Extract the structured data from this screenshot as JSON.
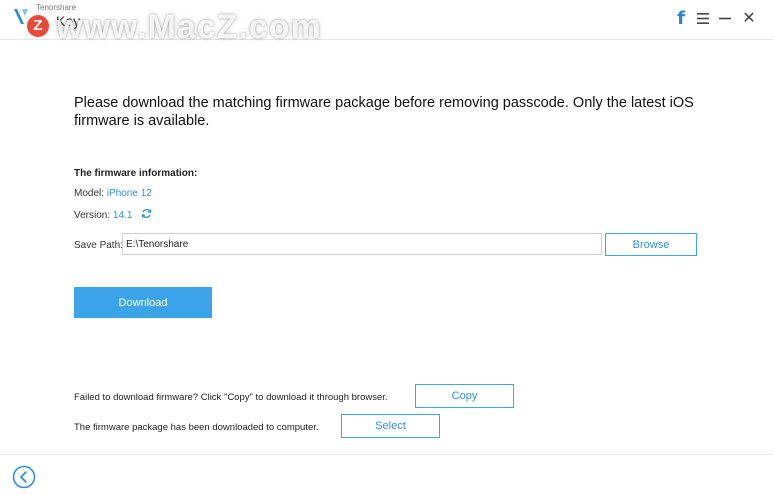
{
  "header": {
    "company": "Tenorshare",
    "app_name": "Key",
    "watermark_text": "www.MacZ.com",
    "watermark_badge": "Z",
    "facebook_label": "f",
    "close_label": "✕"
  },
  "main": {
    "heading": "Please download the matching firmware package before removing passcode. Only the latest iOS firmware is available.",
    "info_title": "The firmware information:",
    "model_label": "Model:",
    "model_value": "iPhone 12",
    "version_label": "Version:",
    "version_value": "14.1",
    "save_path_label": "Save Path:",
    "save_path_value": "E:\\Tenorshare",
    "browse_label": "Browse",
    "download_label": "Download",
    "fail_text": "Failed to download firmware? Click \"Copy\" to download it through browser.",
    "copy_label": "Copy",
    "downloaded_text": "The firmware package has been downloaded to computer.",
    "select_label": "Select"
  },
  "colors": {
    "accent": "#3ba4e8",
    "link": "#2f8fd6",
    "facebook": "#2b82d9"
  }
}
